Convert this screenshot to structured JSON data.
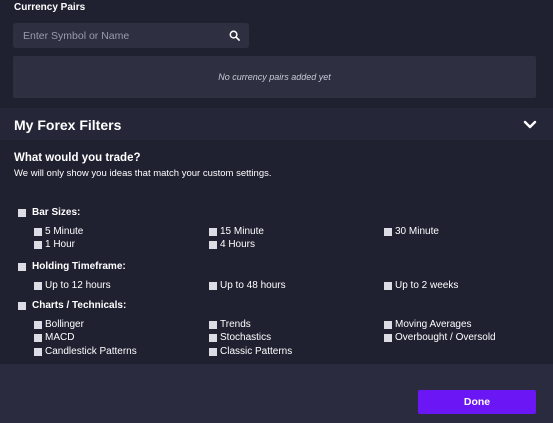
{
  "currency_pairs": {
    "title": "Currency Pairs",
    "search_placeholder": "Enter Symbol or Name",
    "search_value": "",
    "empty_message": "No currency pairs added yet"
  },
  "filters": {
    "title": "My Forex Filters",
    "question": "What would you trade?",
    "subtitle": "We will only show you ideas that match your custom settings.",
    "groups": [
      {
        "label": "Bar Sizes:",
        "checked": false,
        "options": [
          {
            "label": "5 Minute",
            "checked": false
          },
          {
            "label": "15 Minute",
            "checked": false
          },
          {
            "label": "30 Minute",
            "checked": false
          },
          {
            "label": "1 Hour",
            "checked": false
          },
          {
            "label": "4 Hours",
            "checked": false
          }
        ]
      },
      {
        "label": "Holding Timeframe:",
        "checked": false,
        "options": [
          {
            "label": "Up to 12 hours",
            "checked": false
          },
          {
            "label": "Up to 48 hours",
            "checked": false
          },
          {
            "label": "Up to 2 weeks",
            "checked": false
          }
        ]
      },
      {
        "label": "Charts / Technicals:",
        "checked": false,
        "options": [
          {
            "label": "Bollinger",
            "checked": false
          },
          {
            "label": "Trends",
            "checked": false
          },
          {
            "label": "Moving Averages",
            "checked": false
          },
          {
            "label": "MACD",
            "checked": false
          },
          {
            "label": "Stochastics",
            "checked": false
          },
          {
            "label": "Overbought / Oversold",
            "checked": false
          },
          {
            "label": "Candlestick Patterns",
            "checked": false
          },
          {
            "label": "Classic Patterns",
            "checked": false
          }
        ]
      }
    ]
  },
  "footer": {
    "done_label": "Done"
  },
  "colors": {
    "background": "#252638",
    "panel": "#1f2030",
    "input": "#2e3042",
    "accent": "#6b17f5"
  },
  "icons": {
    "search": "search-icon",
    "collapse": "chevron-down-icon"
  }
}
